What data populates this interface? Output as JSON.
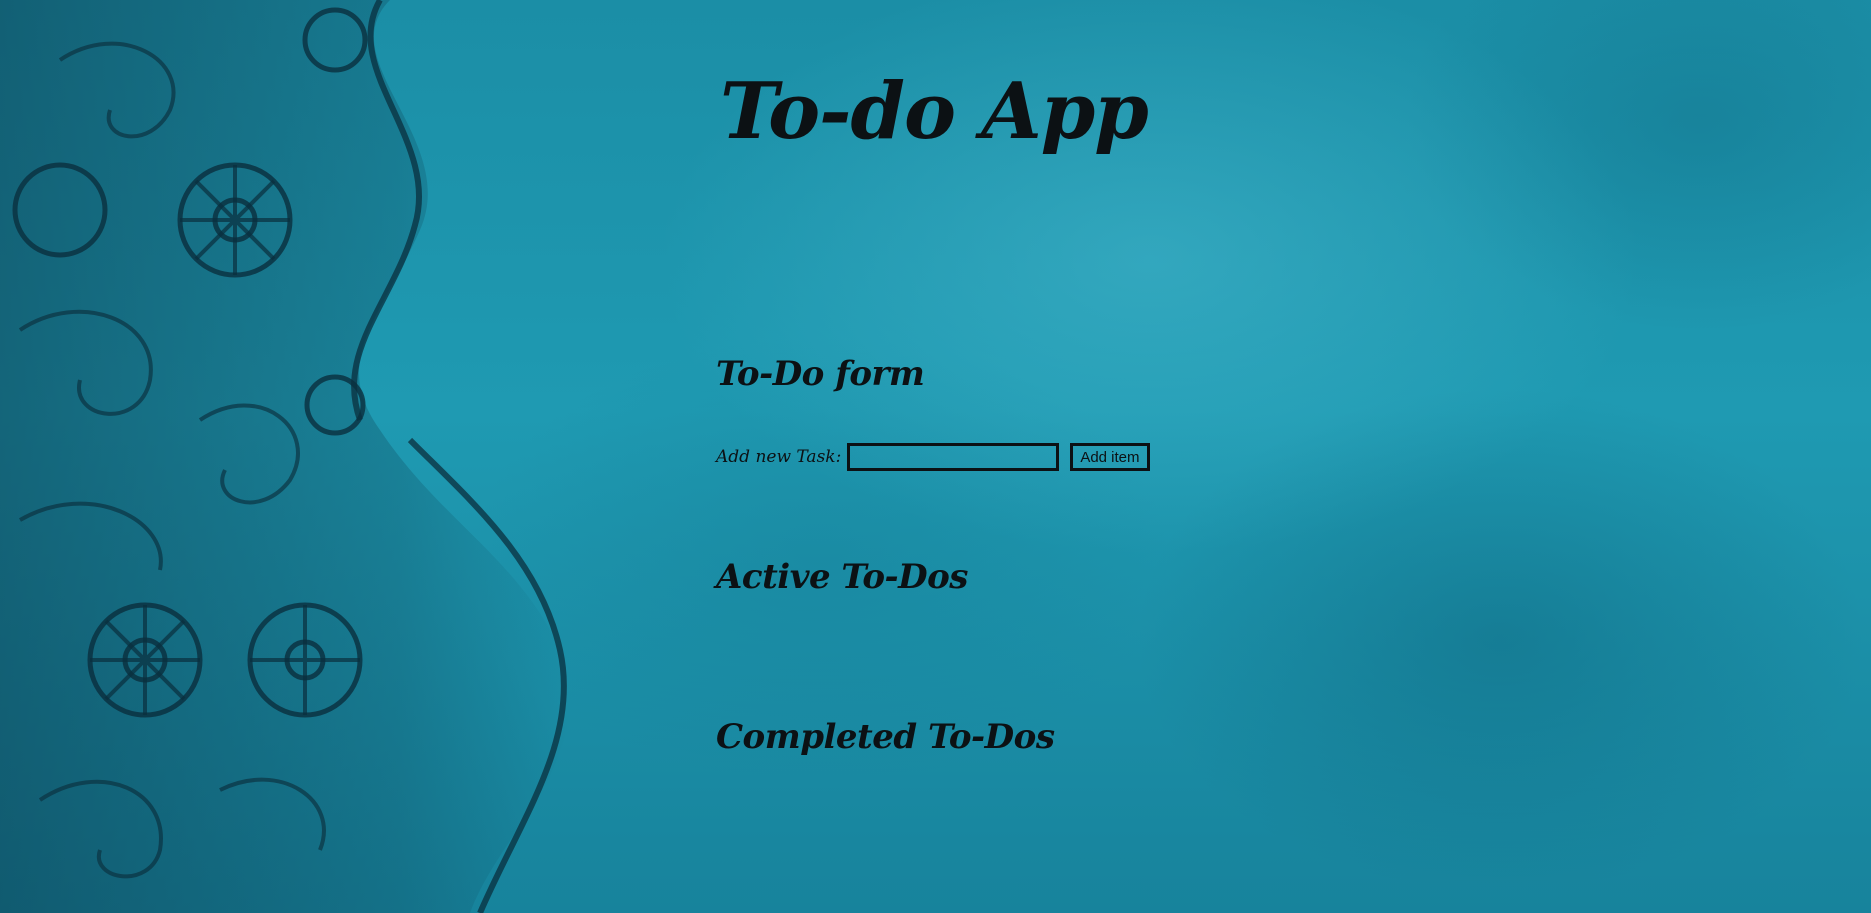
{
  "app": {
    "title": "To-do App"
  },
  "form": {
    "heading": "To-Do form",
    "task_label": "Add new Task:",
    "task_value": "",
    "add_button_label": "Add item"
  },
  "active": {
    "heading": "Active To-Dos",
    "items": []
  },
  "completed": {
    "heading": "Completed To-Dos",
    "items": []
  },
  "colors": {
    "background": "#1b8ea6",
    "text": "#0c1114",
    "ornament": "#0d3f52"
  }
}
